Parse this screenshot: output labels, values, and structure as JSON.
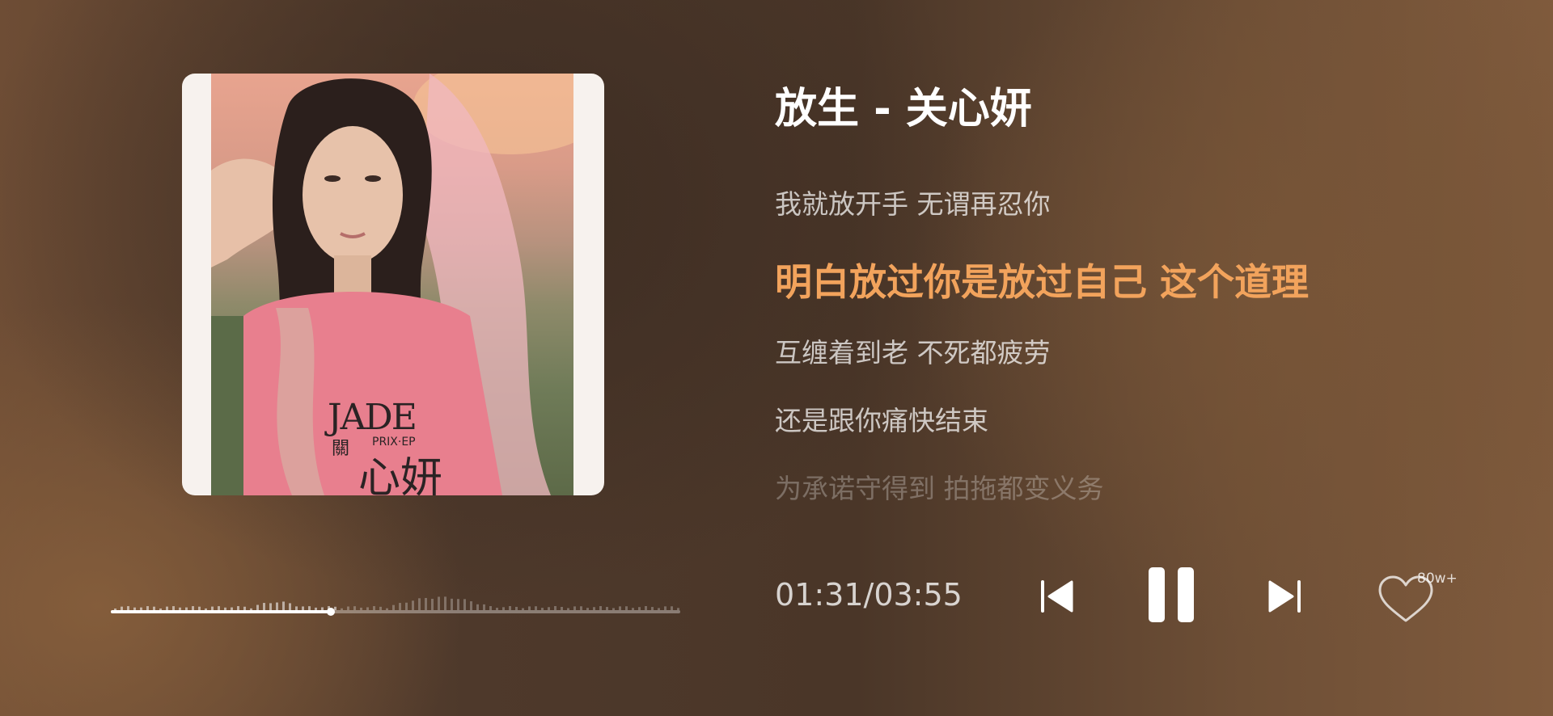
{
  "song": {
    "title": "放生 - 关心妍"
  },
  "album_cover": {
    "artist_brand": "JADE",
    "cover_text_1": "關",
    "cover_text_2": "PRIX·EP",
    "cover_text_3": "心妍"
  },
  "lyrics": [
    {
      "text": "我就放开手 无谓再忍你",
      "state": "past"
    },
    {
      "text": "明白放过你是放过自己 这个道理",
      "state": "current"
    },
    {
      "text": "互缠着到老 不死都疲劳",
      "state": "upcoming"
    },
    {
      "text": "还是跟你痛快结束",
      "state": "upcoming"
    },
    {
      "text": "为承诺守得到 拍拖都变义务",
      "state": "upcoming-faded"
    }
  ],
  "playback": {
    "time_display": "01:31/03:55",
    "progress_fraction": 0.387,
    "buffered_fraction": 0.39
  },
  "controls": {
    "prev_icon": "skip-previous-icon",
    "pause_icon": "pause-icon",
    "next_icon": "skip-next-icon",
    "like_icon": "heart-outline-icon",
    "like_count": "80w+"
  },
  "colors": {
    "accent_lyric": "#f2a35c",
    "text_primary": "#ffffff"
  }
}
